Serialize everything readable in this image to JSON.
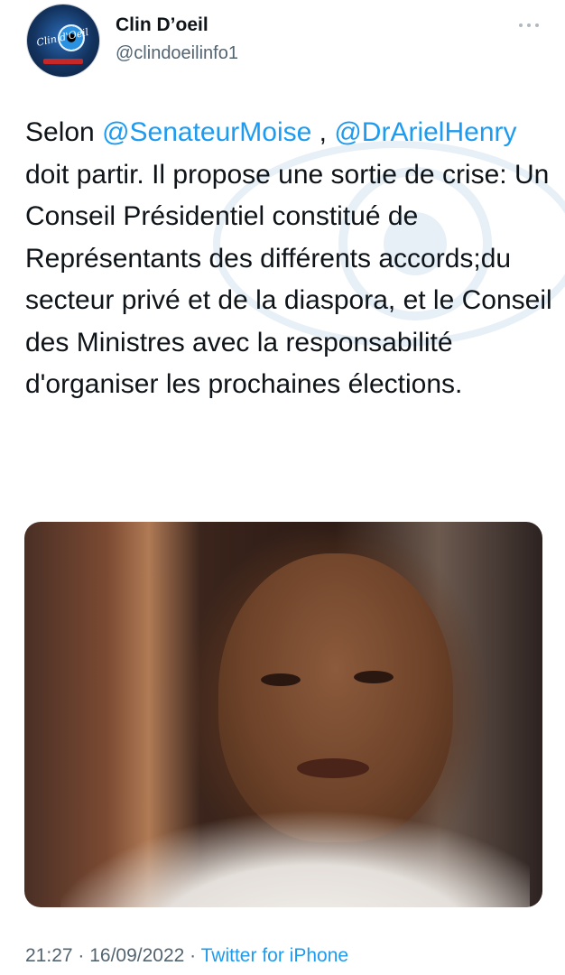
{
  "author": {
    "display_name": "Clin D’oeil",
    "handle": "@clindoeilinfo1"
  },
  "tweet": {
    "prefix": "Selon ",
    "mention1": "@SenateurMoise",
    "between": " , ",
    "mention2": "@DrArielHenry",
    "body": " doit partir. Il propose une sortie de crise: Un Conseil Présidentiel constitué de Représentants des différents accords;du secteur privé et de la diaspora, et le Conseil des Ministres avec la responsabilité d'organiser les prochaines élections."
  },
  "meta": {
    "time": "21:27",
    "separator1": " · ",
    "date": "16/09/2022",
    "separator2": " · ",
    "source": "Twitter for iPhone"
  },
  "colors": {
    "link": "#1d9bf0",
    "secondary_text": "#536471"
  },
  "icons": {
    "more": "more-horizontal-icon"
  }
}
